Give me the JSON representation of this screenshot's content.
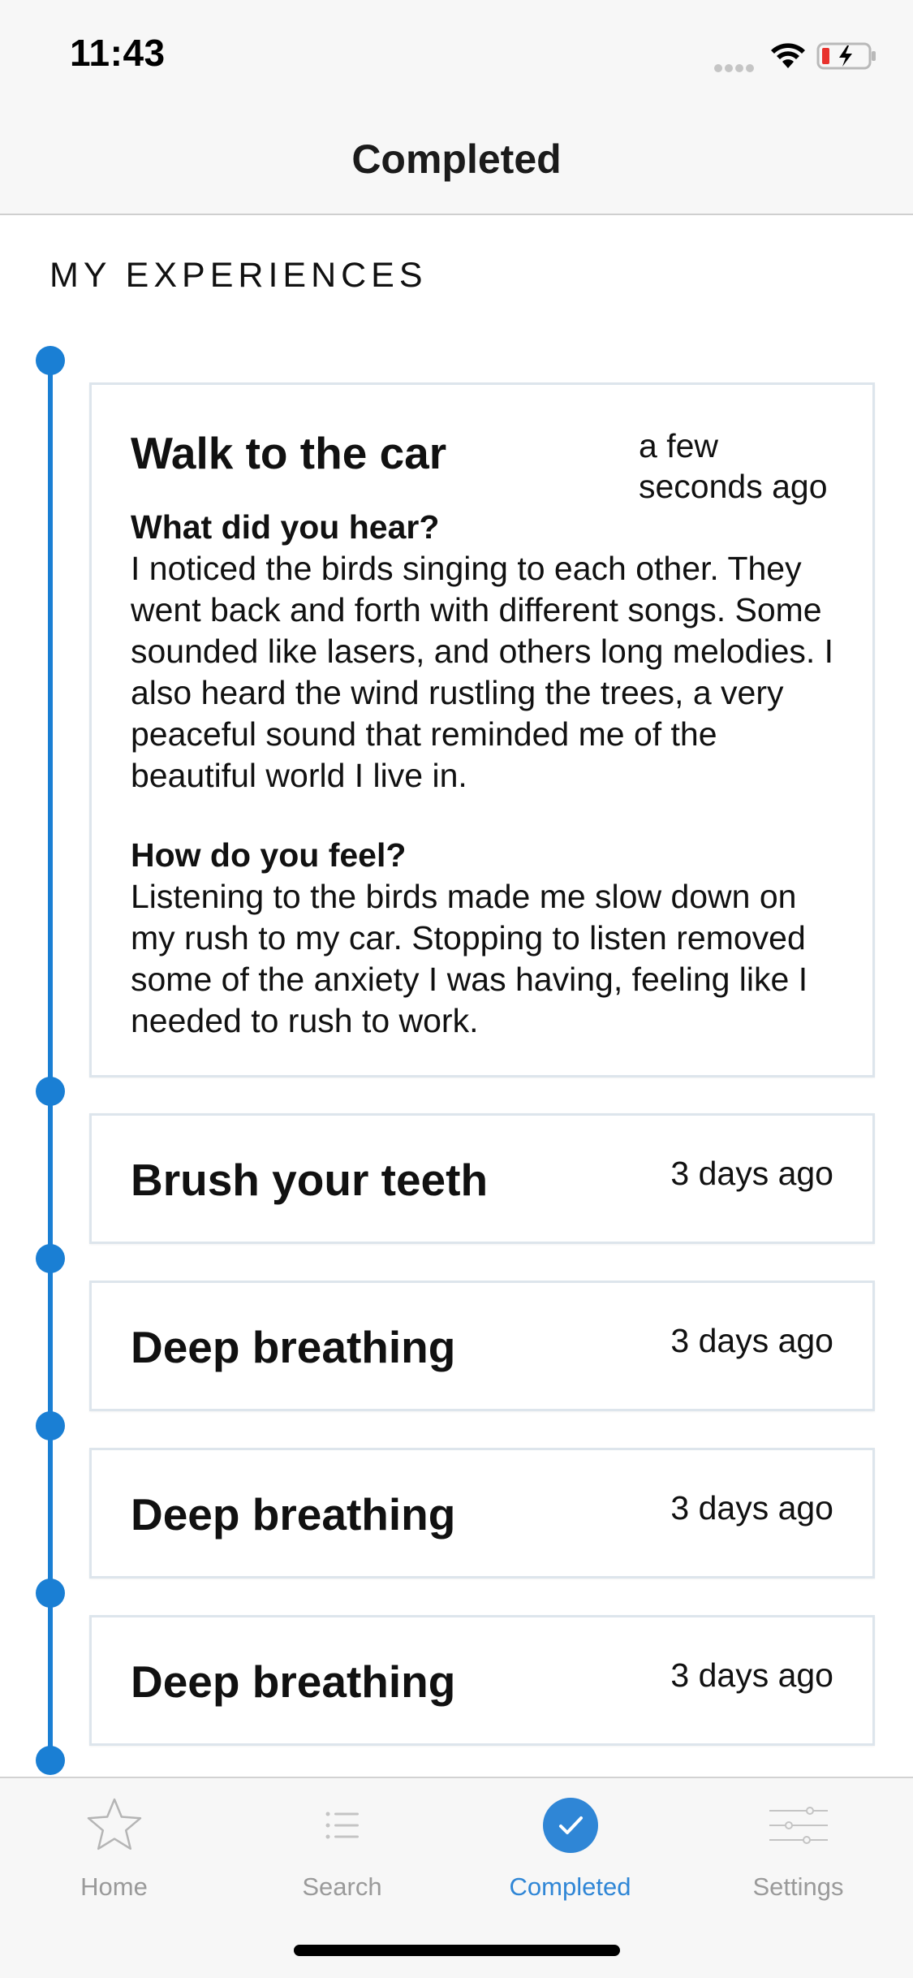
{
  "status": {
    "time": "11:43"
  },
  "nav": {
    "title": "Completed"
  },
  "section": {
    "title": "MY EXPERIENCES"
  },
  "experiences": [
    {
      "title": "Walk to the car",
      "time_line1": "a few",
      "time_line2": "seconds ago",
      "q1_label": "What did you hear?",
      "q1_answer": "I noticed the birds singing to each other. They went back and forth with different songs. Some sounded like lasers, and others long melodies. I also heard the wind rustling the trees, a very peaceful sound that reminded me of the beautiful world I live in.",
      "q2_label": "How do you feel?",
      "q2_answer": "Listening to the birds made me slow down on my rush to my car. Stopping to listen removed some of the anxiety I was having, feeling like I needed to rush to work."
    },
    {
      "title": "Brush your teeth",
      "time": "3 days ago"
    },
    {
      "title": "Deep breathing",
      "time": "3 days ago"
    },
    {
      "title": "Deep breathing",
      "time": "3 days ago"
    },
    {
      "title": "Deep breathing",
      "time": "3 days ago"
    }
  ],
  "tabs": [
    {
      "label": "Home",
      "icon": "star-icon"
    },
    {
      "label": "Search",
      "icon": "list-icon"
    },
    {
      "label": "Completed",
      "icon": "check-circle-icon",
      "active": true
    },
    {
      "label": "Settings",
      "icon": "sliders-icon"
    }
  ],
  "colors": {
    "accent": "#1a7fd4",
    "tab_active": "#2f86d6",
    "tab_inactive": "#9a9a9a"
  }
}
